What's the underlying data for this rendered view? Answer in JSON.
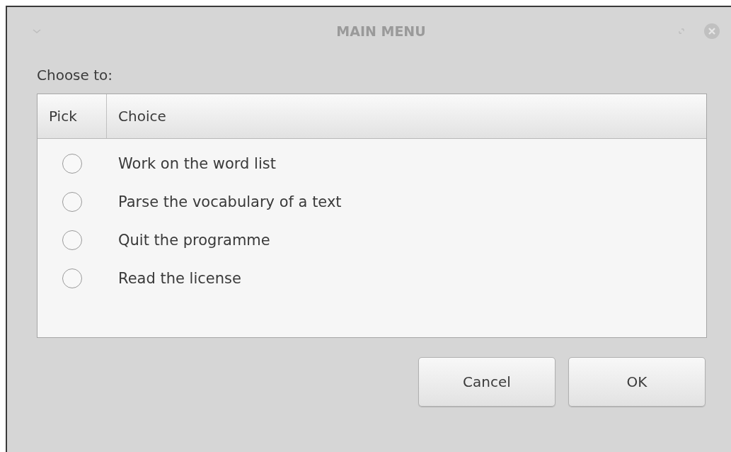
{
  "window": {
    "title": "MAIN MENU"
  },
  "prompt": "Choose to:",
  "table": {
    "columns": [
      "Pick",
      "Choice"
    ],
    "rows": [
      {
        "choice": "Work on the word list",
        "selected": false
      },
      {
        "choice": "Parse the vocabulary of a text",
        "selected": false
      },
      {
        "choice": "Quit the programme",
        "selected": false
      },
      {
        "choice": "Read the license",
        "selected": false
      }
    ]
  },
  "buttons": [
    "Cancel",
    "OK"
  ]
}
